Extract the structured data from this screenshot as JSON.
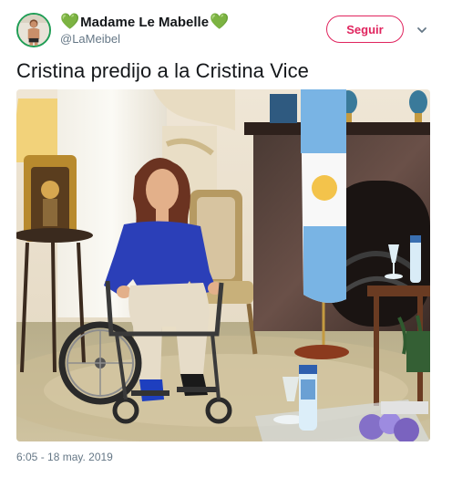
{
  "tweet": {
    "author": {
      "display_name": "Madame Le Mabelle",
      "name_emoji_left": "💚",
      "name_emoji_right": "💚",
      "handle": "@LaMeibel"
    },
    "follow_button_label": "Seguir",
    "menu_icon": "chevron-down-icon",
    "text": "Cristina predijo a la Cristina Vice",
    "timestamp": "6:05 - 18 may. 2019"
  },
  "colors": {
    "follow_accent": "#e0245e",
    "heart": "#3fbf5a",
    "muted_text": "#657786"
  }
}
